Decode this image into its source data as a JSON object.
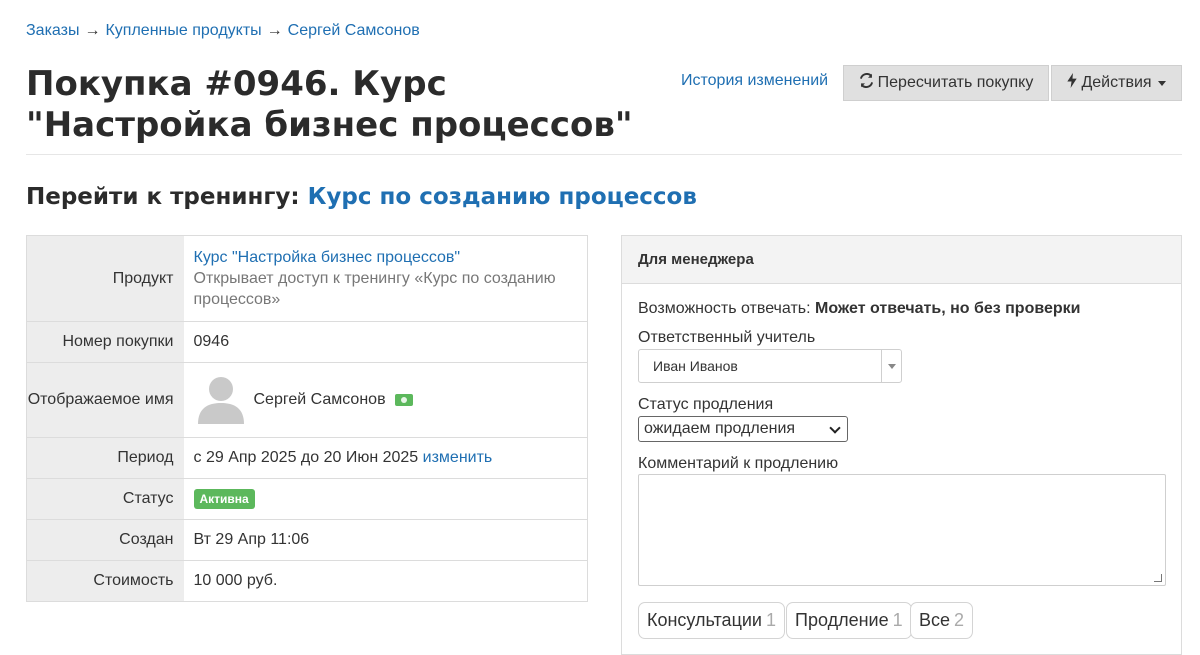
{
  "breadcrumb": {
    "items": [
      "Заказы",
      "Купленные продукты",
      "Сергей Самсонов"
    ],
    "separator": "→"
  },
  "page": {
    "title": "Покупка #0946. Курс \"Настройка бизнес процессов\"",
    "history_link": "История изменений",
    "recalc_button": "Пересчитать покупку",
    "actions_button": "Действия",
    "goto_label": "Перейти к тренингу:",
    "goto_link": "Курс по созданию процессов"
  },
  "info": {
    "product_label": "Продукт",
    "product_link": "Курс \"Настройка бизнес процессов\"",
    "product_desc": "Открывает доступ к тренингу «Курс по созданию процессов»",
    "number_label": "Номер покупки",
    "number_value": "0946",
    "display_name_label": "Отображаемое имя",
    "display_name_value": "Сергей Самсонов",
    "period_label": "Период",
    "period_value": "с 29 Апр 2025 до 20 Июн 2025",
    "period_change": "изменить",
    "status_label": "Статус",
    "status_value": "Активна",
    "created_label": "Создан",
    "created_value": "Вт 29 Апр 11:06",
    "cost_label": "Стоимость",
    "cost_value": "10 000 руб."
  },
  "manager": {
    "panel_title": "Для менеджера",
    "reply_label": "Возможность отвечать:",
    "reply_value": "Может отвечать, но без проверки",
    "teacher_label": "Ответственный учитель",
    "teacher_value": "Иван Иванов",
    "renewal_label": "Статус продления",
    "renewal_value": "ожидаем продления",
    "comment_label": "Комментарий к продлению",
    "comment_value": "",
    "tabs": [
      {
        "label": "Консультации",
        "count": "1"
      },
      {
        "label": "Продление",
        "count": "1"
      },
      {
        "label": "Все",
        "count": "2"
      }
    ]
  },
  "colors": {
    "link": "#1f6fb2",
    "active_badge": "#5cb85c",
    "button_gray": "#e0e0e0"
  }
}
